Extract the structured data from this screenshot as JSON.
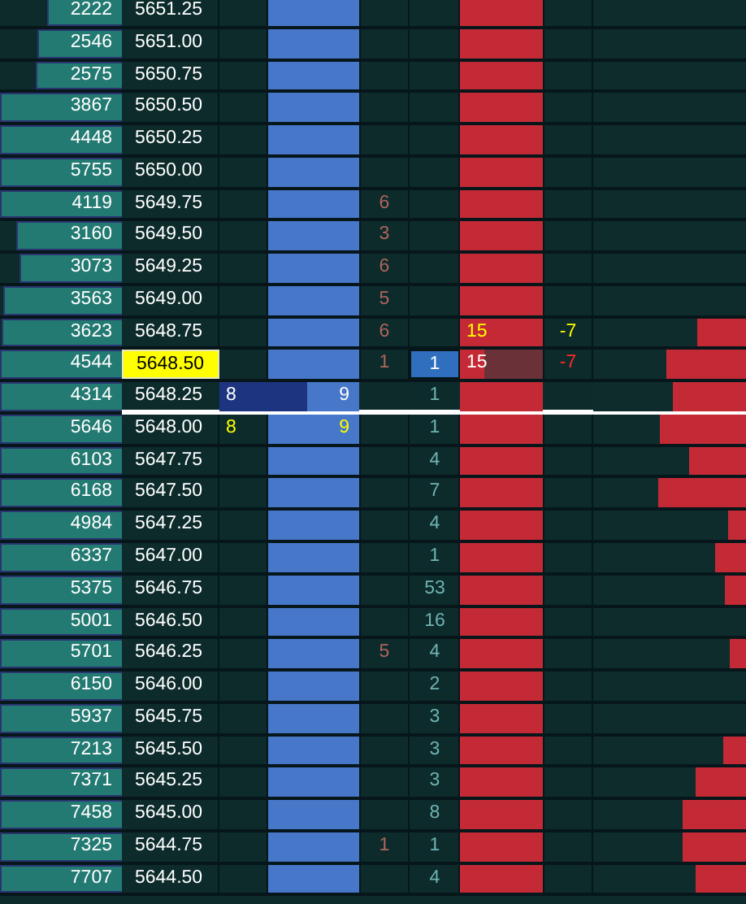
{
  "rows": [
    {
      "kind": "plain",
      "volume_bar": {
        "value": "2222"
      },
      "price": "5651.25",
      "selected": false
    },
    {
      "kind": "plain",
      "volume_bar": {
        "value": "2546"
      },
      "price": "5651.00",
      "selected": false
    },
    {
      "kind": "plain",
      "volume_bar": {
        "value": "2575"
      },
      "price": "5650.75",
      "selected": false
    },
    {
      "kind": "plain",
      "volume_bar": {
        "value": "3867"
      },
      "price": "5650.50",
      "selected": false
    },
    {
      "kind": "plain",
      "volume_bar": {
        "value": "4448"
      },
      "price": "5650.25",
      "selected": false
    },
    {
      "kind": "plain",
      "volume_bar": {
        "value": "5755"
      },
      "price": "5650.00",
      "selected": false
    },
    {
      "kind": "plain",
      "volume_bar": {
        "value": "4119"
      },
      "price": "5649.75",
      "selected": false,
      "trades": "6"
    },
    {
      "kind": "plain",
      "volume_bar": {
        "value": "3160"
      },
      "price": "5649.50",
      "selected": false,
      "trades": "3"
    },
    {
      "kind": "plain",
      "volume_bar": {
        "value": "3073"
      },
      "price": "5649.25",
      "selected": false,
      "trades": "6"
    },
    {
      "kind": "plain",
      "volume_bar": {
        "value": "3563"
      },
      "price": "5649.00",
      "selected": false,
      "trades": "5"
    },
    {
      "kind": "flash",
      "volume_bar": {
        "value": "3623"
      },
      "price": "5648.75",
      "selected": false,
      "trades": "6",
      "ask": "15",
      "delta": "-7",
      "depth_bar": {
        "level": 0.32
      }
    },
    {
      "kind": "current",
      "volume_bar": {
        "value": "4544"
      },
      "price": "5648.50",
      "selected": true,
      "trades": "1",
      "volume": "1",
      "ask": "15",
      "delta": "-7",
      "depth_bar": {
        "level": 0.52
      }
    },
    {
      "kind": "working",
      "volume_bar": {
        "value": "4314"
      },
      "price": "5648.25",
      "selected": false,
      "orders": "8",
      "bid": "9",
      "volume": "1",
      "depth_bar": {
        "level": 0.48
      }
    },
    {
      "kind": "flash",
      "volume_bar": {
        "value": "5646"
      },
      "price": "5648.00",
      "selected": false,
      "orders": "8",
      "bid": "9",
      "volume": "1",
      "depth_bar": {
        "level": 0.56
      }
    },
    {
      "kind": "plain",
      "volume_bar": {
        "value": "6103"
      },
      "price": "5647.75",
      "selected": false,
      "volume": "4",
      "depth_bar": {
        "level": 0.37
      }
    },
    {
      "kind": "plain",
      "volume_bar": {
        "value": "6168"
      },
      "price": "5647.50",
      "selected": false,
      "volume": "7",
      "depth_bar": {
        "level": 0.57
      }
    },
    {
      "kind": "plain",
      "volume_bar": {
        "value": "4984"
      },
      "price": "5647.25",
      "selected": false,
      "volume": "4",
      "depth_bar": {
        "level": 0.12
      }
    },
    {
      "kind": "plain",
      "volume_bar": {
        "value": "6337"
      },
      "price": "5647.00",
      "selected": false,
      "volume": "1",
      "depth_bar": {
        "level": 0.2
      }
    },
    {
      "kind": "plain",
      "volume_bar": {
        "value": "5375"
      },
      "price": "5646.75",
      "selected": false,
      "volume": "53",
      "depth_bar": {
        "level": 0.14
      }
    },
    {
      "kind": "plain",
      "volume_bar": {
        "value": "5001"
      },
      "price": "5646.50",
      "selected": false,
      "volume": "16"
    },
    {
      "kind": "plain",
      "volume_bar": {
        "value": "5701"
      },
      "price": "5646.25",
      "selected": false,
      "trades": "5",
      "volume": "4",
      "depth_bar": {
        "level": 0.11
      }
    },
    {
      "kind": "plain",
      "volume_bar": {
        "value": "6150"
      },
      "price": "5646.00",
      "selected": false,
      "volume": "2"
    },
    {
      "kind": "plain",
      "volume_bar": {
        "value": "5937"
      },
      "price": "5645.75",
      "selected": false,
      "volume": "3"
    },
    {
      "kind": "plain",
      "volume_bar": {
        "value": "7213"
      },
      "price": "5645.50",
      "selected": false,
      "volume": "3",
      "depth_bar": {
        "level": 0.15
      }
    },
    {
      "kind": "plain",
      "volume_bar": {
        "value": "7371"
      },
      "price": "5645.25",
      "selected": false,
      "volume": "3",
      "depth_bar": {
        "level": 0.33
      }
    },
    {
      "kind": "plain",
      "volume_bar": {
        "value": "7458"
      },
      "price": "5645.00",
      "selected": false,
      "volume": "8",
      "depth_bar": {
        "level": 0.41
      }
    },
    {
      "kind": "plain",
      "volume_bar": {
        "value": "7325"
      },
      "price": "5644.75",
      "selected": false,
      "trades": "1",
      "volume": "1",
      "depth_bar": {
        "level": 0.42
      }
    },
    {
      "kind": "plain",
      "volume_bar": {
        "value": "7707"
      },
      "price": "5644.50",
      "selected": false,
      "volume": "4",
      "depth_bar": {
        "level": 0.33
      }
    }
  ]
}
